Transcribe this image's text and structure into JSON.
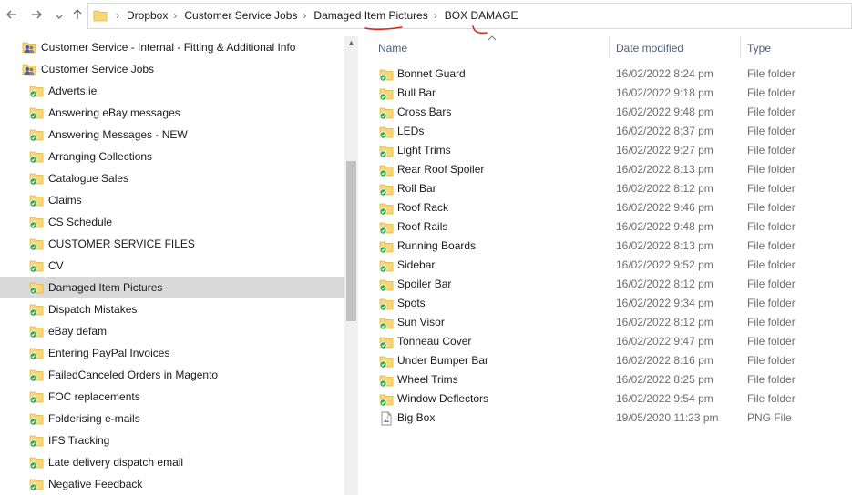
{
  "nav": {
    "back_icon": "arrow-left-icon",
    "forward_icon": "arrow-right-icon",
    "recent_icon": "chevron-down-icon",
    "up_icon": "arrow-up-icon"
  },
  "breadcrumb": [
    "Dropbox",
    "Customer Service Jobs",
    "Damaged Item Pictures",
    "BOX DAMAGE"
  ],
  "tree": {
    "items": [
      {
        "label": "Customer Service - Internal - Fitting & Additional Info",
        "icon": "shared-folder-icon",
        "indent": 0
      },
      {
        "label": "Customer Service Jobs",
        "icon": "shared-folder-icon",
        "indent": 0
      },
      {
        "label": "Adverts.ie",
        "icon": "synced-folder-icon",
        "indent": 1
      },
      {
        "label": "Answering eBay messages",
        "icon": "synced-folder-icon",
        "indent": 1
      },
      {
        "label": "Answering Messages - NEW",
        "icon": "synced-folder-icon",
        "indent": 1
      },
      {
        "label": "Arranging Collections",
        "icon": "synced-folder-icon",
        "indent": 1
      },
      {
        "label": "Catalogue Sales",
        "icon": "synced-folder-icon",
        "indent": 1
      },
      {
        "label": "Claims",
        "icon": "synced-folder-icon",
        "indent": 1
      },
      {
        "label": "CS Schedule",
        "icon": "synced-folder-icon",
        "indent": 1
      },
      {
        "label": "CUSTOMER SERVICE FILES",
        "icon": "synced-folder-icon",
        "indent": 1
      },
      {
        "label": "CV",
        "icon": "synced-folder-icon",
        "indent": 1
      },
      {
        "label": "Damaged Item Pictures",
        "icon": "synced-folder-icon",
        "indent": 1,
        "selected": true
      },
      {
        "label": "Dispatch Mistakes",
        "icon": "synced-folder-icon",
        "indent": 1
      },
      {
        "label": "eBay defam",
        "icon": "synced-folder-icon",
        "indent": 1
      },
      {
        "label": "Entering PayPal Invoices",
        "icon": "synced-folder-icon",
        "indent": 1
      },
      {
        "label": "FailedCanceled Orders in Magento",
        "icon": "synced-folder-icon",
        "indent": 1
      },
      {
        "label": "FOC replacements",
        "icon": "synced-folder-icon",
        "indent": 1
      },
      {
        "label": "Folderising e-mails",
        "icon": "synced-folder-icon",
        "indent": 1
      },
      {
        "label": "IFS Tracking",
        "icon": "synced-folder-icon",
        "indent": 1
      },
      {
        "label": "Late delivery dispatch email",
        "icon": "synced-folder-icon",
        "indent": 1
      },
      {
        "label": "Negative Feedback",
        "icon": "synced-folder-icon",
        "indent": 1
      }
    ]
  },
  "list": {
    "columns": {
      "name": "Name",
      "date": "Date modified",
      "type": "Type"
    },
    "rows": [
      {
        "name": "Bonnet Guard",
        "date": "16/02/2022 8:24 pm",
        "type": "File folder",
        "icon": "folder-icon"
      },
      {
        "name": "Bull Bar",
        "date": "16/02/2022 9:18 pm",
        "type": "File folder",
        "icon": "folder-icon"
      },
      {
        "name": "Cross Bars",
        "date": "16/02/2022 9:48 pm",
        "type": "File folder",
        "icon": "folder-icon"
      },
      {
        "name": "LEDs",
        "date": "16/02/2022 8:37 pm",
        "type": "File folder",
        "icon": "folder-icon"
      },
      {
        "name": "Light Trims",
        "date": "16/02/2022 9:27 pm",
        "type": "File folder",
        "icon": "folder-icon"
      },
      {
        "name": "Rear Roof Spoiler",
        "date": "16/02/2022 8:13 pm",
        "type": "File folder",
        "icon": "folder-icon"
      },
      {
        "name": "Roll Bar",
        "date": "16/02/2022 8:12 pm",
        "type": "File folder",
        "icon": "folder-icon"
      },
      {
        "name": "Roof Rack",
        "date": "16/02/2022 9:46 pm",
        "type": "File folder",
        "icon": "folder-icon"
      },
      {
        "name": "Roof Rails",
        "date": "16/02/2022 9:48 pm",
        "type": "File folder",
        "icon": "folder-icon"
      },
      {
        "name": "Running Boards",
        "date": "16/02/2022 8:13 pm",
        "type": "File folder",
        "icon": "folder-icon"
      },
      {
        "name": "Sidebar",
        "date": "16/02/2022 9:52 pm",
        "type": "File folder",
        "icon": "folder-icon"
      },
      {
        "name": "Spoiler Bar",
        "date": "16/02/2022 8:12 pm",
        "type": "File folder",
        "icon": "folder-icon"
      },
      {
        "name": "Spots",
        "date": "16/02/2022 9:34 pm",
        "type": "File folder",
        "icon": "folder-icon"
      },
      {
        "name": "Sun Visor",
        "date": "16/02/2022 8:12 pm",
        "type": "File folder",
        "icon": "folder-icon"
      },
      {
        "name": "Tonneau Cover",
        "date": "16/02/2022 9:47 pm",
        "type": "File folder",
        "icon": "folder-icon"
      },
      {
        "name": "Under Bumper Bar",
        "date": "16/02/2022 8:16 pm",
        "type": "File folder",
        "icon": "folder-icon"
      },
      {
        "name": "Wheel Trims",
        "date": "16/02/2022 8:25 pm",
        "type": "File folder",
        "icon": "folder-icon"
      },
      {
        "name": "Window Deflectors",
        "date": "16/02/2022 9:54 pm",
        "type": "File folder",
        "icon": "folder-icon"
      },
      {
        "name": "Big Box",
        "date": "19/05/2020 11:23 pm",
        "type": "PNG File",
        "icon": "png-file-icon"
      }
    ]
  },
  "colors": {
    "folder_yellow": "#f8d775",
    "folder_dark": "#e0b540",
    "sync_green": "#2fa84f",
    "selected_bg": "#d9d9d9",
    "annotation_red": "#e0241b",
    "header_text": "#4c607a"
  }
}
